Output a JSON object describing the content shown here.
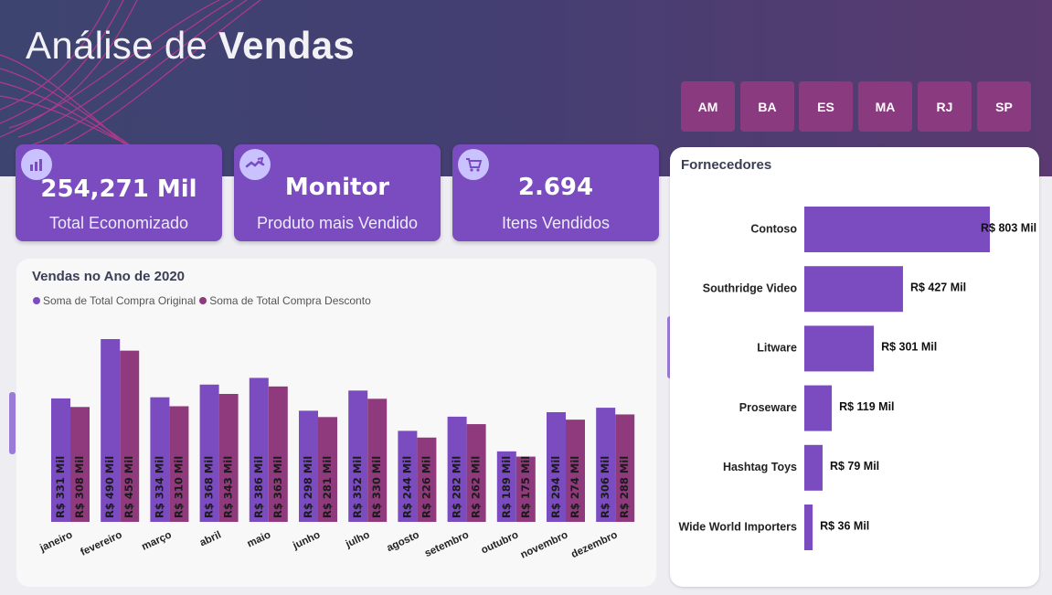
{
  "header": {
    "title_light": "Análise de",
    "title_bold": "Vendas"
  },
  "states": [
    "AM",
    "BA",
    "ES",
    "MA",
    "RJ",
    "SP"
  ],
  "kpis": [
    {
      "value": "254,271 Mil",
      "label": "Total Economizado",
      "icon": "bar-chart-icon"
    },
    {
      "value": "Monitor",
      "label": "Produto mais Vendido",
      "icon": "handshake-icon"
    },
    {
      "value": "2.694",
      "label": "Itens Vendidos",
      "icon": "cart-icon"
    }
  ],
  "colors": {
    "original": "#7a4cc0",
    "desconto": "#8e3a7c",
    "state_button": "#8a3a7f"
  },
  "sales_chart": {
    "title": "Vendas no Ano de 2020",
    "legend": [
      "Soma de Total Compra Original",
      "Soma de Total Compra Desconto"
    ]
  },
  "suppliers_panel": {
    "title": "Fornecedores"
  },
  "chart_data": [
    {
      "type": "bar",
      "title": "Vendas no Ano de 2020",
      "categories": [
        "janeiro",
        "fevereiro",
        "março",
        "abril",
        "maio",
        "junho",
        "julho",
        "agosto",
        "setembro",
        "outubro",
        "novembro",
        "dezembro"
      ],
      "series": [
        {
          "name": "Soma de Total Compra Original",
          "values": [
            331,
            490,
            334,
            368,
            386,
            298,
            352,
            244,
            282,
            189,
            294,
            306
          ],
          "labels": [
            "R$ 331 Mil",
            "R$ 490 Mil",
            "R$ 334 Mil",
            "R$ 368 Mil",
            "R$ 386 Mil",
            "R$ 298 Mil",
            "R$ 352 Mil",
            "R$ 244 Mil",
            "R$ 282 Mil",
            "R$ 189 Mil",
            "R$ 294 Mil",
            "R$ 306 Mil"
          ]
        },
        {
          "name": "Soma de Total Compra Desconto",
          "values": [
            308,
            459,
            310,
            343,
            363,
            281,
            330,
            226,
            262,
            175,
            274,
            288
          ],
          "labels": [
            "R$ 308 Mil",
            "R$ 459 Mil",
            "R$ 310 Mil",
            "R$ 343 Mil",
            "R$ 363 Mil",
            "R$ 281 Mil",
            "R$ 330 Mil",
            "R$ 226 Mil",
            "R$ 262 Mil",
            "R$ 175 Mil",
            "R$ 274 Mil",
            "R$ 288 Mil"
          ]
        }
      ],
      "ylim": [
        0,
        490
      ],
      "legend_position": "top-left",
      "grid": false
    },
    {
      "type": "bar",
      "orientation": "horizontal",
      "title": "Fornecedores",
      "categories": [
        "Contoso",
        "Southridge Video",
        "Litware",
        "Proseware",
        "Hashtag Toys",
        "Wide World Importers"
      ],
      "values": [
        803,
        427,
        301,
        119,
        79,
        36
      ],
      "labels": [
        "R$ 803 Mil",
        "R$ 427 Mil",
        "R$ 301 Mil",
        "R$ 119 Mil",
        "R$ 79 Mil",
        "R$ 36 Mil"
      ],
      "xlim": [
        0,
        803
      ],
      "grid": false
    }
  ]
}
